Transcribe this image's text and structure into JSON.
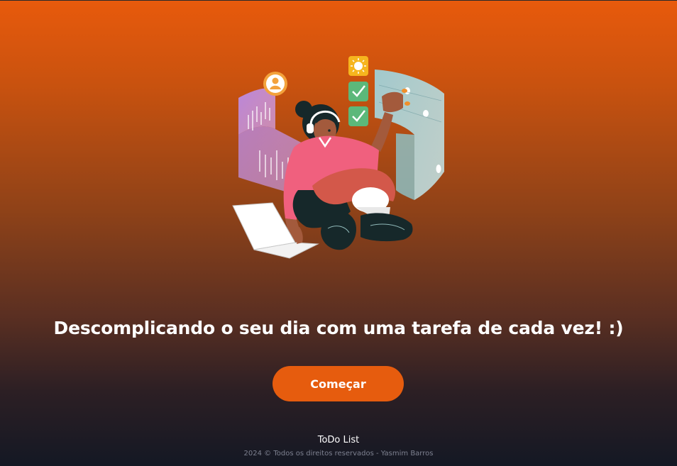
{
  "main": {
    "tagline": "Descomplicando o seu dia com uma tarefa de cada vez! :)",
    "start_button_label": "Começar"
  },
  "footer": {
    "title": "ToDo List",
    "copyright": "2024 © Todos os direitos reservados - Yasmim Barros"
  },
  "hero": {
    "illustration": "woman-multitasking-illustration",
    "icons": [
      "sun-icon",
      "checkmark-icon",
      "checkmark-icon",
      "user-icon",
      "laptop-icon",
      "headphones-icon"
    ]
  },
  "colors": {
    "accent": "#e65c0e",
    "background_top": "#e85a0c",
    "background_bottom": "#141824",
    "text": "#ffffff",
    "muted_text": "#7d8190"
  }
}
